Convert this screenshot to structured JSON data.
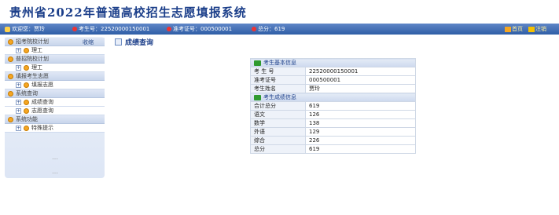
{
  "header": {
    "title": "贵州省2022年普通高校招生志愿填报系统"
  },
  "infobar": {
    "welcome": "欢迎您：贾玲",
    "exam_no_label": "考生号：",
    "exam_no": "22520000150001",
    "id_label": "准考证号：",
    "id_no": "000500001",
    "score_label": "总分：",
    "score": "619",
    "home": "首页",
    "logout": "注销"
  },
  "sidebar": {
    "collapse": "收缩",
    "groups": [
      {
        "label": "招考院校计划",
        "items": [
          "理工"
        ]
      },
      {
        "label": "普招院校计划",
        "items": [
          "理工"
        ]
      },
      {
        "label": "填报考生志愿",
        "items": [
          "填报志愿"
        ]
      },
      {
        "label": "系统查询",
        "items": [
          "成绩查询",
          "志愿查询"
        ]
      },
      {
        "label": "系统功能",
        "items": [
          "特殊提示"
        ]
      }
    ],
    "scroll": "…"
  },
  "main": {
    "title": "成绩查询",
    "basic_section": "考生基本信息",
    "basic": [
      {
        "k": "考 生 号",
        "v": "22520000150001"
      },
      {
        "k": "准考证号",
        "v": "000500001"
      },
      {
        "k": "考生姓名",
        "v": "贾玲"
      }
    ],
    "score_section": "考生成绩信息",
    "scores": [
      {
        "k": "合计总分",
        "v": "619"
      },
      {
        "k": "语文",
        "v": "126"
      },
      {
        "k": "数学",
        "v": "138"
      },
      {
        "k": "外语",
        "v": "129"
      },
      {
        "k": "综合",
        "v": "226"
      },
      {
        "k": "总分",
        "v": "619"
      }
    ]
  }
}
